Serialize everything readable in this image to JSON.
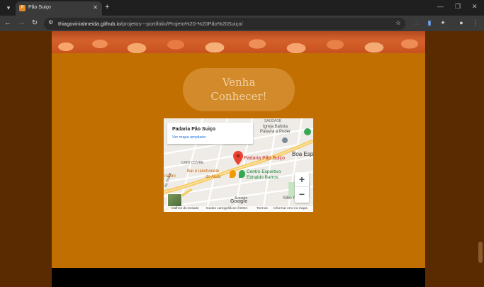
{
  "browser": {
    "tab_title": "Pão Suiço",
    "tab_favicon": "P",
    "new_tab_label": "+",
    "url_host": "thiagovinialmeida.github.io",
    "url_path": "/projetos---portifolio/Projeto%20-%20P%C3%A3o%20Sui%C3%A7o/",
    "url_path_display": "/projetos---portifolio/Projeto%20-%20Pão%20Suiço/"
  },
  "page": {
    "visit_line1": "Venha",
    "visit_line2": "Conhecer!",
    "colors": {
      "background": "#5a2a00",
      "column": "#c06f00",
      "button": "#d28a2b",
      "button_text": "#f2d2a3"
    }
  },
  "map": {
    "place_name": "Padaria Pão Suiço",
    "enlarged_link": "Ver mapa ampliado",
    "pin_label": "Padaria Pão Suiço",
    "labels": {
      "saudade": "SAUDADE",
      "church_line1": "Igreja Batista",
      "church_line2": "Palavra e Poder",
      "boa_esp": "Boa Esp",
      "ilmo_covre": "ILMO COVRE",
      "snack_line1": "Bar e lanchonete",
      "snack_line2": "do Aiubi",
      "sports_line1": "Centro Esportivo",
      "sports_line2": "Ednaldo Barros",
      "mazini": "nazini",
      "sitio": "Sitio marc",
      "avenida": "Avenida",
      "street": "do Trabal"
    },
    "zoom_in": "+",
    "zoom_out": "−",
    "logo": "Google",
    "attribution": {
      "shortcuts": "Atalhos do teclado",
      "data": "Dados cartográficos ©2024",
      "terms": "Termos",
      "report": "Informar erro no mapa"
    }
  }
}
